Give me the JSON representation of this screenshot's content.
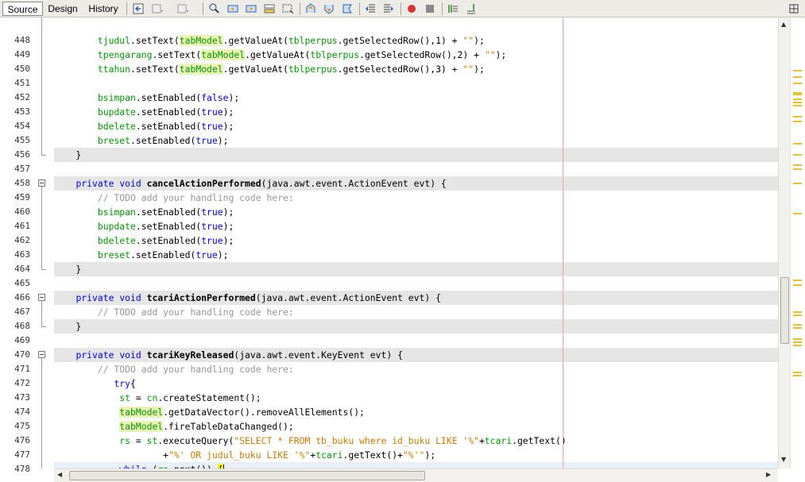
{
  "tabs": {
    "source": "Source",
    "design": "Design",
    "history": "History"
  },
  "toolbar": {
    "icons": [
      "last-edit-icon",
      "back-icon",
      "forward-icon",
      "find-icon",
      "find-prev-icon",
      "find-next-icon",
      "toggle-highlight-icon",
      "toggle-rect-select-icon",
      "prev-bookmark-icon",
      "next-bookmark-icon",
      "toggle-bookmark-icon",
      "shift-left-icon",
      "shift-right-icon",
      "record-macro-icon",
      "stop-macro-icon",
      "comment-icon",
      "uncomment-icon"
    ],
    "expand_icon": "maximize-icon"
  },
  "editor": {
    "line_numbers": [
      "448",
      "449",
      "450",
      "451",
      "452",
      "453",
      "454",
      "455",
      "456",
      "457",
      "458",
      "459",
      "460",
      "461",
      "462",
      "463",
      "464",
      "465",
      "466",
      "467",
      "468",
      "469",
      "470",
      "471",
      "472",
      "473",
      "474",
      "475",
      "476",
      "477",
      "478"
    ],
    "lines": [
      "        tjudul.setText(tabModel.getValueAt(tblperpus.getSelectedRow(),1) + \"\");",
      "        tpengarang.setText(tabModel.getValueAt(tblperpus.getSelectedRow(),2) + \"\");",
      "        ttahun.setText(tabModel.getValueAt(tblperpus.getSelectedRow(),3) + \"\");",
      "",
      "        bsimpan.setEnabled(false);",
      "        bupdate.setEnabled(true);",
      "        bdelete.setEnabled(true);",
      "        breset.setEnabled(true);",
      "    }",
      "",
      "    private void cancelActionPerformed(java.awt.event.ActionEvent evt) {",
      "        // TODO add your handling code here:",
      "        bsimpan.setEnabled(true);",
      "        bupdate.setEnabled(true);",
      "        bdelete.setEnabled(true);",
      "        breset.setEnabled(true);",
      "    }",
      "",
      "    private void tcariActionPerformed(java.awt.event.ActionEvent evt) {",
      "        // TODO add your handling code here:",
      "    }",
      "",
      "    private void tcariKeyReleased(java.awt.event.KeyEvent evt) {",
      "        // TODO add your handling code here:",
      "           try{",
      "            st = cn.createStatement();",
      "            tabModel.getDataVector().removeAllElements();",
      "            tabModel.fireTableDataChanged();",
      "            rs = st.executeQuery(\"SELECT * FROM tb_buku where id_buku LIKE '%\"+tcari.getText()",
      "                    +\"%' OR judul_buku LIKE '%\"+tcari.getText()+\"%'\");",
      "            while (rs.next()) {"
    ]
  },
  "colors": {
    "keyword": "#0000e6",
    "comment": "#969696",
    "string": "#ce7b00",
    "field": "#009900",
    "highlight": "#ecf2b6",
    "error_stripe_mark": "#e6c229"
  }
}
